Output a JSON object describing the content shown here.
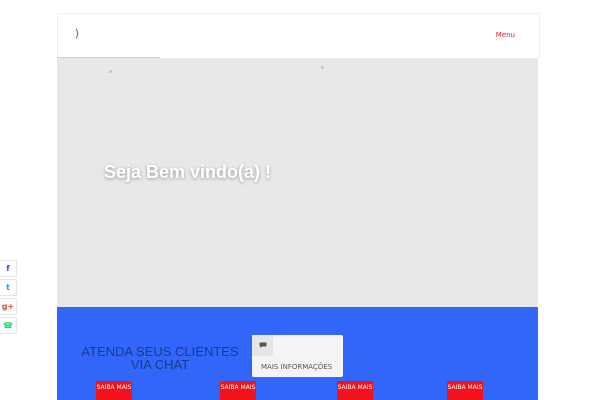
{
  "header": {
    "logo_glyph": "⟩",
    "menu_label": "Menu"
  },
  "hero": {
    "title": "Seja Bem vindo(a) !"
  },
  "chat_section": {
    "heading": "ATENDA SEUS CLIENTES VIA CHAT",
    "info_card": {
      "icon": "comment-icon",
      "label": "MAIS INFORMAÇÕES"
    },
    "faint_text": "..."
  },
  "saiba_buttons": [
    {
      "label": "SAIBA MAIS"
    },
    {
      "label": "SAIBA MAIS"
    },
    {
      "label": "SAIBA MAIS"
    },
    {
      "label": "SAIBA MAIS"
    }
  ],
  "social": [
    {
      "icon": "facebook-icon",
      "glyph": "f",
      "color": "#3b5998"
    },
    {
      "icon": "twitter-icon",
      "glyph": "t",
      "color": "#1da1f2"
    },
    {
      "icon": "google-plus-icon",
      "glyph": "g+",
      "color": "#dd4b39"
    },
    {
      "icon": "whatsapp-icon",
      "glyph": "☎",
      "color": "#25d366"
    }
  ],
  "colors": {
    "accent_red": "#f2121b",
    "band_blue": "#3166f8",
    "hero_gray": "#e8e8e8"
  }
}
